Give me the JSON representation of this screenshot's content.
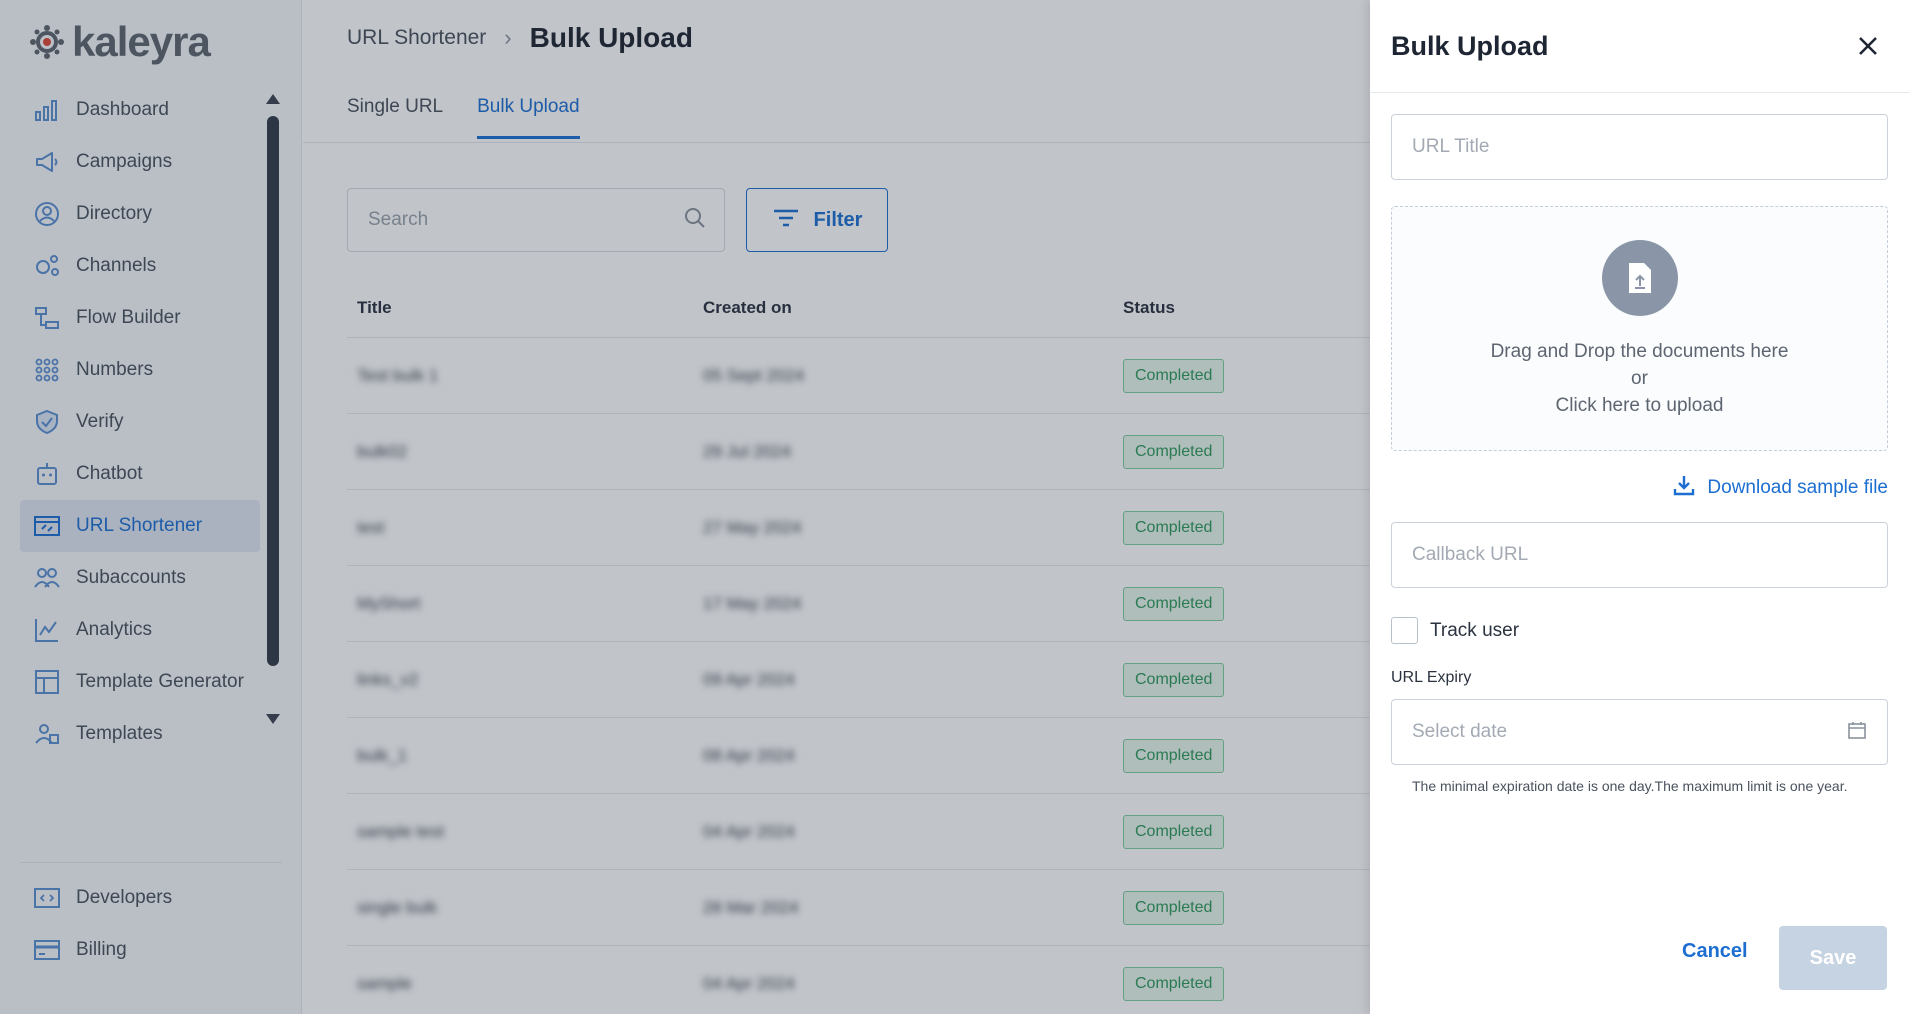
{
  "brand": {
    "name": "kaleyra"
  },
  "sidebar": {
    "items": [
      {
        "label": "Dashboard",
        "icon": "bar-chart-icon"
      },
      {
        "label": "Campaigns",
        "icon": "megaphone-icon"
      },
      {
        "label": "Directory",
        "icon": "contact-icon"
      },
      {
        "label": "Channels",
        "icon": "channels-icon"
      },
      {
        "label": "Flow Builder",
        "icon": "flow-icon"
      },
      {
        "label": "Numbers",
        "icon": "dial-pad-icon"
      },
      {
        "label": "Verify",
        "icon": "shield-icon"
      },
      {
        "label": "Chatbot",
        "icon": "robot-icon"
      },
      {
        "label": "URL Shortener",
        "icon": "link-icon",
        "active": true
      },
      {
        "label": "Subaccounts",
        "icon": "users-icon"
      },
      {
        "label": "Analytics",
        "icon": "analytics-icon"
      },
      {
        "label": "Template Generator",
        "icon": "template-generator-icon"
      },
      {
        "label": "Templates",
        "icon": "templates-icon"
      }
    ],
    "bottom_items": [
      {
        "label": "Developers",
        "icon": "code-icon"
      },
      {
        "label": "Billing",
        "icon": "card-icon"
      }
    ]
  },
  "header": {
    "breadcrumb_parent": "URL Shortener",
    "breadcrumb_current": "Bulk Upload"
  },
  "tabs": [
    {
      "label": "Single URL",
      "active": false
    },
    {
      "label": "Bulk Upload",
      "active": true
    }
  ],
  "toolbar": {
    "search_placeholder": "Search",
    "filter_label": "Filter"
  },
  "table": {
    "columns": [
      "Title",
      "Created on",
      "Status"
    ],
    "rows": [
      {
        "title": "Test bulk 1",
        "created_on": "05 Sept 2024",
        "status": "Completed"
      },
      {
        "title": "bulk02",
        "created_on": "29 Jul 2024",
        "status": "Completed"
      },
      {
        "title": "test",
        "created_on": "27 May 2024",
        "status": "Completed"
      },
      {
        "title": "MyShort",
        "created_on": "17 May 2024",
        "status": "Completed"
      },
      {
        "title": "links_v2",
        "created_on": "09 Apr 2024",
        "status": "Completed"
      },
      {
        "title": "bulk_1",
        "created_on": "08 Apr 2024",
        "status": "Completed"
      },
      {
        "title": "sample test",
        "created_on": "04 Apr 2024",
        "status": "Completed"
      },
      {
        "title": "single bulk",
        "created_on": "28 Mar 2024",
        "status": "Completed"
      },
      {
        "title": "sample",
        "created_on": "04 Apr 2024",
        "status": "Completed"
      }
    ]
  },
  "drawer": {
    "title": "Bulk Upload",
    "url_title_placeholder": "URL Title",
    "dropzone": {
      "line1": "Drag and Drop the documents here",
      "line2": "or",
      "line3": "Click here to upload"
    },
    "download_label": "Download sample file",
    "callback_placeholder": "Callback URL",
    "track_user_label": "Track user",
    "expiry_label": "URL Expiry",
    "date_placeholder": "Select date",
    "hint": "The minimal expiration date is one day.The maximum limit is one year.",
    "cancel_label": "Cancel",
    "save_label": "Save"
  },
  "colors": {
    "accent": "#1c6fd1",
    "status_green": "#2e9a5b",
    "overlay": "rgba(32,44,62,0.28)"
  }
}
